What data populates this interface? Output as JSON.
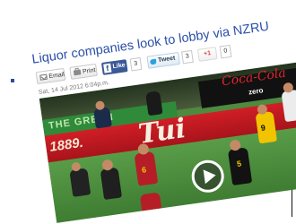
{
  "article": {
    "headline": "Liquor companies look to lobby via NZRU",
    "dateline": "Sat, 14 Jul 2012 6:04p.m."
  },
  "share_bar": {
    "email_label": "Email",
    "print_label": "Print",
    "facebook": {
      "icon_glyph": "f",
      "label": "Like",
      "count": "3"
    },
    "twitter": {
      "label": "Tweet",
      "count": "3"
    },
    "googleplus": {
      "label": "+1",
      "count": "0"
    }
  },
  "video": {
    "banner_green": "THE GREEN",
    "banner_cc_brand": "Coca-Cola",
    "banner_cc_sub": "zero",
    "banner_since": "1889.",
    "banner_brand": "Tui",
    "player_numbers": [
      "5",
      "9",
      "6"
    ]
  },
  "colors": {
    "headline": "#2a4fa8",
    "facebook": "#3b5998",
    "twitter": "#2da1e6",
    "googleplus": "#dd4b39"
  },
  "icons": [
    "email-icon",
    "print-icon",
    "facebook-icon",
    "twitter-icon",
    "play-icon"
  ]
}
